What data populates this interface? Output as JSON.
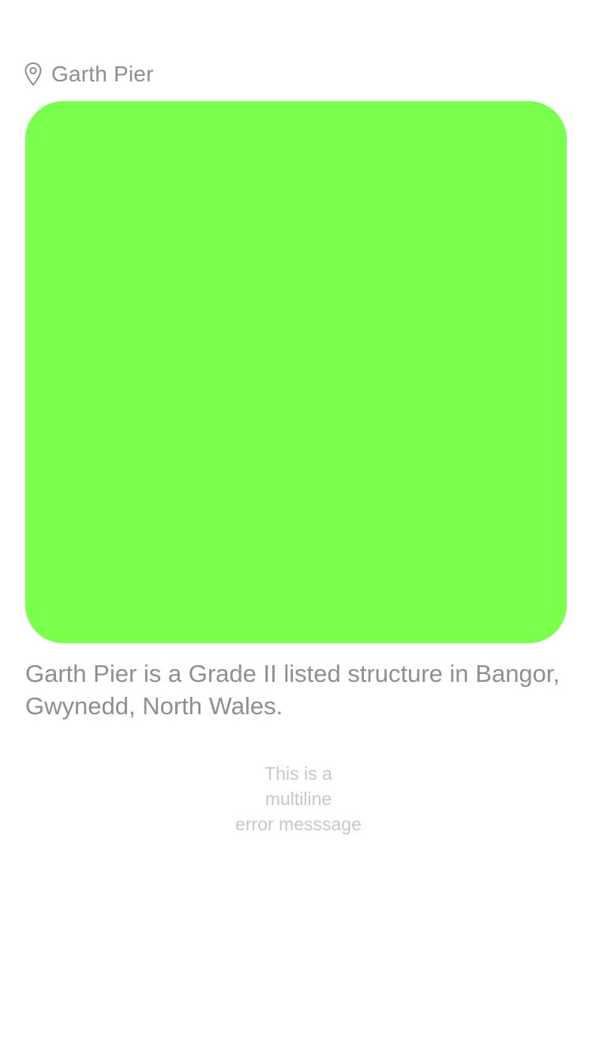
{
  "location": {
    "icon": "map-pin-icon",
    "name": "Garth Pier"
  },
  "photo": {
    "color": "#7aff4d"
  },
  "description": "Garth Pier is a Grade II listed structure in Bangor, Gwynedd, North Wales.",
  "error_message": "This is a\nmultiline\nerror messsage",
  "colors": {
    "secondary_text": "#8e8e93",
    "tertiary_text": "#c7c7cc",
    "background": "#ffffff"
  }
}
